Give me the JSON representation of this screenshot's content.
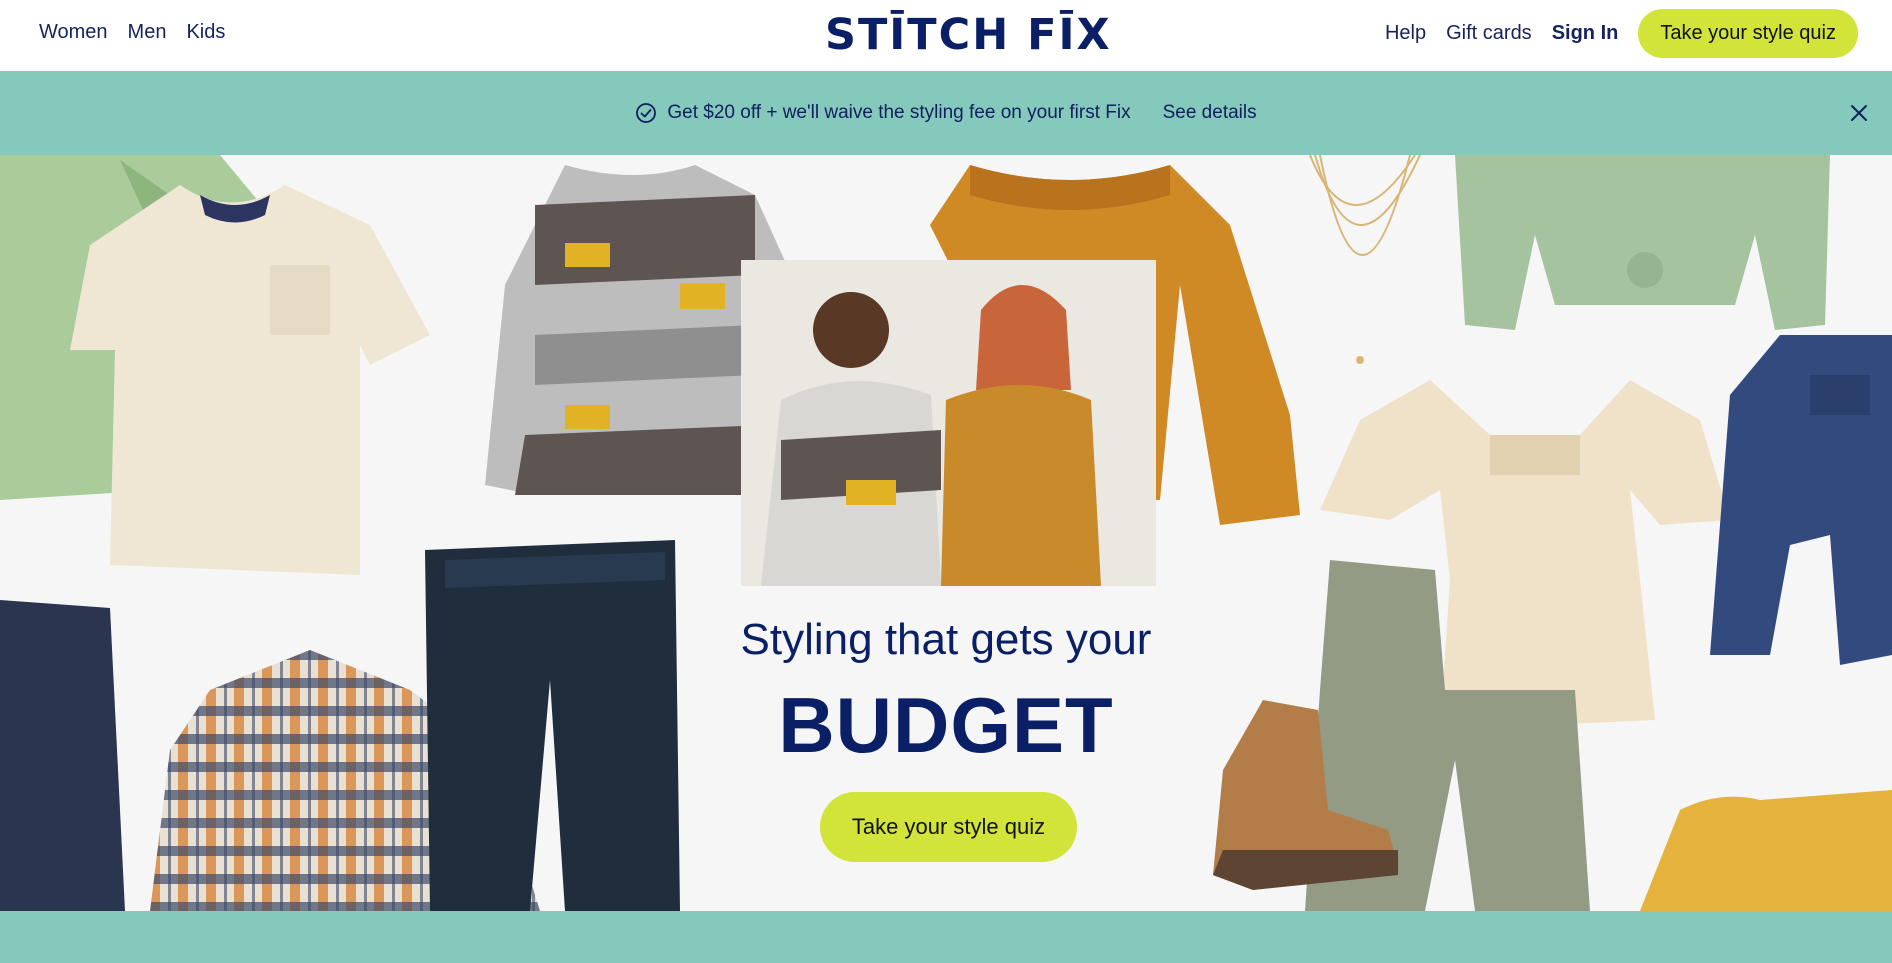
{
  "header": {
    "nav_left": [
      "Women",
      "Men",
      "Kids"
    ],
    "logo_text": "STĪTCH FĪX",
    "help": "Help",
    "gift_cards": "Gift cards",
    "sign_in": "Sign In",
    "quiz_button": "Take your style quiz"
  },
  "promo": {
    "text": "Get $20 off + we'll waive the styling fee on your first Fix",
    "link": "See details",
    "icon": "check-circle-icon",
    "close_icon": "close-icon"
  },
  "hero": {
    "subtitle": "Styling that gets your",
    "title": "BUDGET",
    "quiz_button": "Take your style quiz"
  },
  "colors": {
    "navy": "#0b1f66",
    "teal": "#85c8bc",
    "lime": "#d2e33a",
    "hero_bg": "#f6f6f7"
  }
}
